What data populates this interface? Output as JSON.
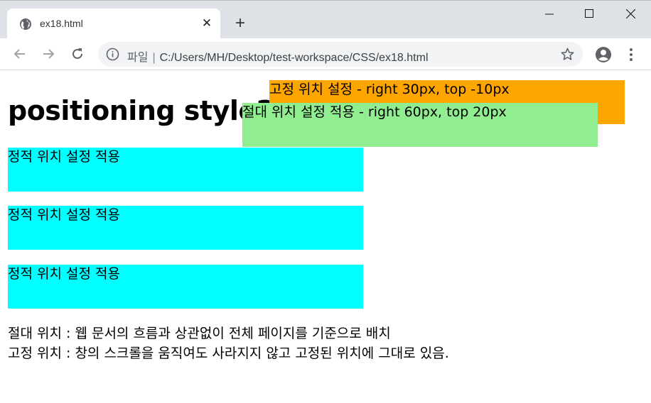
{
  "tab": {
    "title": "ex18.html",
    "close": "✕"
  },
  "new_tab": "+",
  "omnibox": {
    "label": "파일",
    "separator": "|",
    "url": "C:/Users/MH/Desktop/test-workspace/CSS/ex18.html"
  },
  "icons": {
    "tab": "globe-icon",
    "back": "arrow-left-icon",
    "forward": "arrow-right-icon",
    "reload": "reload-icon",
    "info": "info-icon",
    "bookmark": "star-icon",
    "profile": "account-circle-icon",
    "menu": "more-vert-icon",
    "minimize": "minimize-icon",
    "maximize": "maximize-icon",
    "close": "close-icon"
  },
  "page": {
    "heading": "positioning style2",
    "static_boxes": [
      "정적 위치 설정 적용",
      "정적 위치 설정 적용",
      "정적 위치 설정 적용"
    ],
    "fixed_box": "고정 위치 설정 - right 30px, top -10px",
    "absolute_box": "절대 위치 설정 적용 - right 60px, top 20px",
    "notes": [
      "절대 위치 : 웹 문서의 흐름과 상관없이 전체 페이지를 기준으로 배치",
      "고정 위치 : 창의 스크롤을 움직여도 사라지지 않고 고정된 위치에 그대로 있음."
    ]
  },
  "colors": {
    "static": "#00ffff",
    "fixed": "#ffa500",
    "absolute": "#90ee90",
    "chrome": "#dee1e6"
  }
}
